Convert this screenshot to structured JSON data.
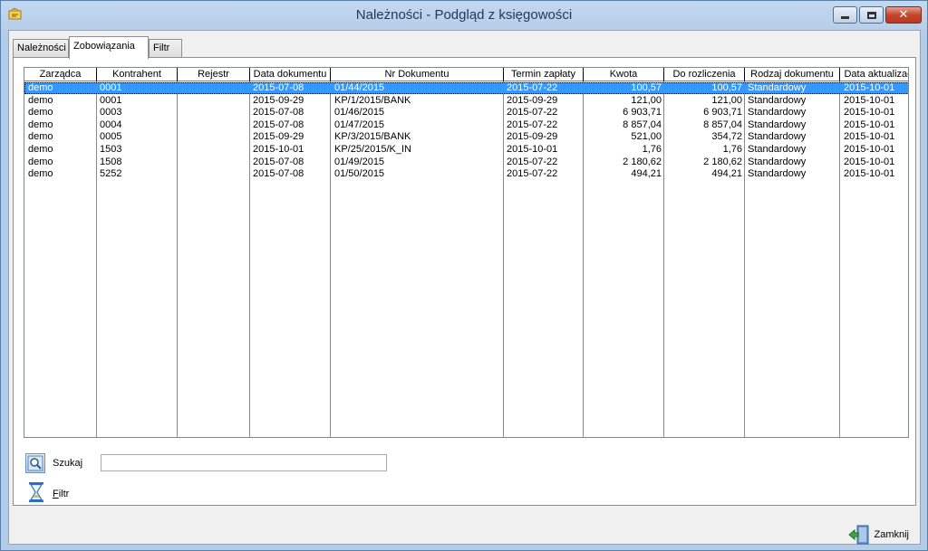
{
  "window": {
    "title": "Należności - Podgląd z księgowości"
  },
  "tabs": [
    {
      "label": "Należności"
    },
    {
      "label": "Zobowiązania"
    },
    {
      "label": "Filtr"
    }
  ],
  "grid": {
    "columns": [
      "Zarządca",
      "Kontrahent",
      "Rejestr",
      "Data dokumentu",
      "Nr Dokumentu",
      "Termin zapłaty",
      "Kwota",
      "Do rozliczenia",
      "Rodzaj dokumentu",
      "Data aktualizacji"
    ],
    "rows": [
      [
        "demo",
        "0001",
        "",
        "2015-07-08",
        "01/44/2015",
        "2015-07-22",
        "100,57",
        "100,57",
        "Standardowy",
        "2015-10-01"
      ],
      [
        "demo",
        "0001",
        "",
        "2015-09-29",
        "KP/1/2015/BANK",
        "2015-09-29",
        "121,00",
        "121,00",
        "Standardowy",
        "2015-10-01"
      ],
      [
        "demo",
        "0003",
        "",
        "2015-07-08",
        "01/46/2015",
        "2015-07-22",
        "6 903,71",
        "6 903,71",
        "Standardowy",
        "2015-10-01"
      ],
      [
        "demo",
        "0004",
        "",
        "2015-07-08",
        "01/47/2015",
        "2015-07-22",
        "8 857,04",
        "8 857,04",
        "Standardowy",
        "2015-10-01"
      ],
      [
        "demo",
        "0005",
        "",
        "2015-09-29",
        "KP/3/2015/BANK",
        "2015-09-29",
        "521,00",
        "354,72",
        "Standardowy",
        "2015-10-01"
      ],
      [
        "demo",
        "1503",
        "",
        "2015-10-01",
        "KP/25/2015/K_IN",
        "2015-10-01",
        "1,76",
        "1,76",
        "Standardowy",
        "2015-10-01"
      ],
      [
        "demo",
        "1508",
        "",
        "2015-07-08",
        "01/49/2015",
        "2015-07-22",
        "2 180,62",
        "2 180,62",
        "Standardowy",
        "2015-10-01"
      ],
      [
        "demo",
        "5252",
        "",
        "2015-07-08",
        "01/50/2015",
        "2015-07-22",
        "494,21",
        "494,21",
        "Standardowy",
        "2015-10-01"
      ]
    ]
  },
  "search": {
    "label": "Szukaj",
    "value": ""
  },
  "filter": {
    "label_first": "F",
    "label_rest": "iltr"
  },
  "footer": {
    "close_label": "Zamknij"
  },
  "colors": {
    "selection": "#3399ff",
    "close_button": "#c4452c"
  }
}
